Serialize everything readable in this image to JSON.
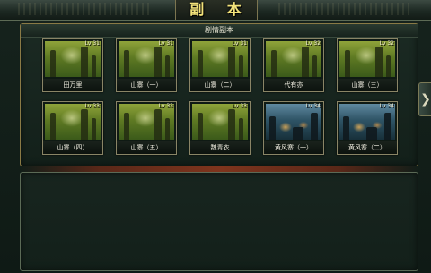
{
  "window": {
    "title": "副 本"
  },
  "panel": {
    "title": "剧情副本"
  },
  "dungeons": [
    {
      "level": "Lv 31",
      "name": "田万里",
      "theme": "forest"
    },
    {
      "level": "Lv 31",
      "name": "山寨（一）",
      "theme": "forest"
    },
    {
      "level": "Lv 31",
      "name": "山寨（二）",
      "theme": "forest"
    },
    {
      "level": "Lv 32",
      "name": "代有亦",
      "theme": "forest"
    },
    {
      "level": "Lv 32",
      "name": "山寨（三）",
      "theme": "forest"
    },
    {
      "level": "Lv 33",
      "name": "山寨（四）",
      "theme": "forest"
    },
    {
      "level": "Lv 33",
      "name": "山寨（五）",
      "theme": "forest"
    },
    {
      "level": "Lv 33",
      "name": "魏青衣",
      "theme": "forest"
    },
    {
      "level": "Lv 34",
      "name": "黄风寨（一）",
      "theme": "night"
    },
    {
      "level": "Lv 34",
      "name": "黄风寨（二）",
      "theme": "night"
    }
  ],
  "side_tab": {
    "glyph": "❯",
    "icon": "chevron-right-icon"
  },
  "colors": {
    "title_gold": "#f2e27a",
    "frame_gold": "#8a7a45",
    "divider_red": "#9a3a1e"
  }
}
